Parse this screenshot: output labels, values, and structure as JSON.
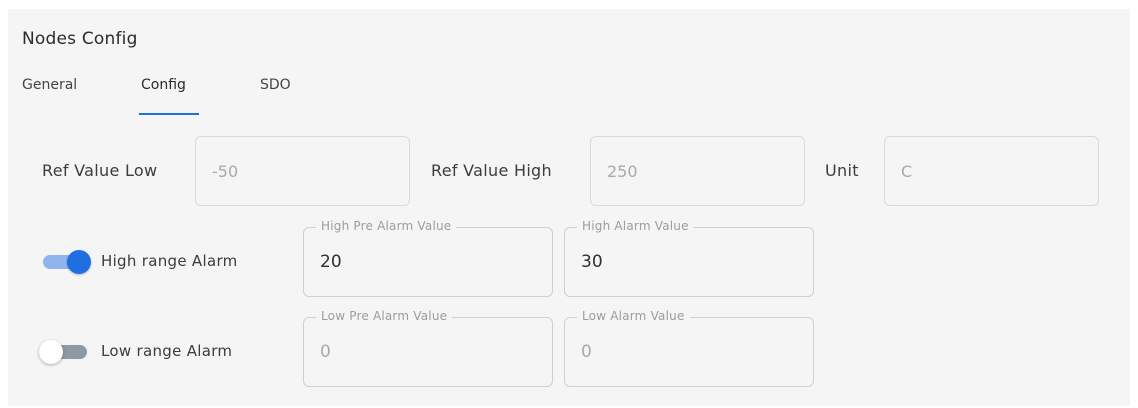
{
  "title": "Nodes Config",
  "tabs": [
    {
      "label": "General",
      "active": false
    },
    {
      "label": "Config",
      "active": true
    },
    {
      "label": "SDO",
      "active": false
    }
  ],
  "ref": {
    "low_label": "Ref Value Low",
    "low_value": "-50",
    "high_label": "Ref Value High",
    "high_value": "250",
    "unit_label": "Unit",
    "unit_value": "C"
  },
  "high_alarm": {
    "toggle_label": "High range Alarm",
    "enabled": true,
    "pre_label": "High Pre Alarm Value",
    "pre_value": "20",
    "alarm_label": "High Alarm Value",
    "alarm_value": "30"
  },
  "low_alarm": {
    "toggle_label": "Low range Alarm",
    "enabled": false,
    "pre_label": "Low Pre Alarm Value",
    "pre_value": "0",
    "alarm_label": "Low Alarm Value",
    "alarm_value": "0"
  },
  "colors": {
    "accent": "#1f6fe0",
    "accent_track": "#90b4ee",
    "off_track": "#8f99a6",
    "panel_bg": "#f5f5f6"
  }
}
